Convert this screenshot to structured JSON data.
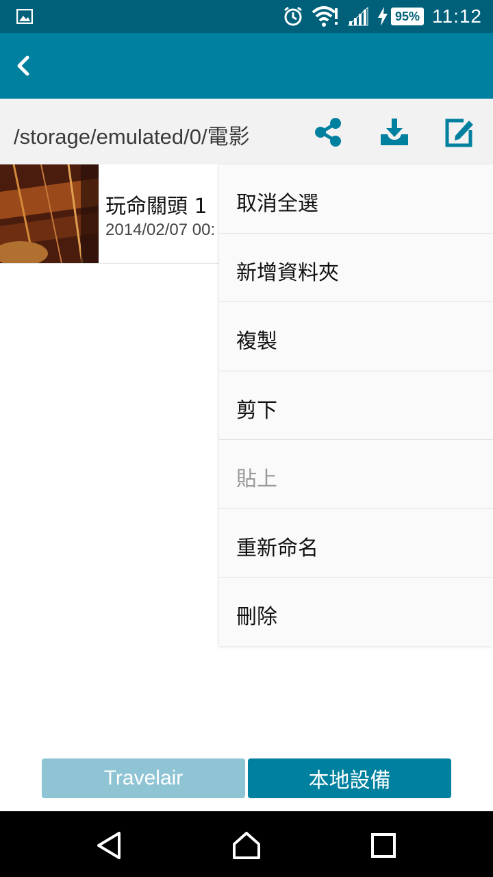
{
  "status_bar": {
    "battery": "95%",
    "time": "11:12",
    "icons": [
      "gallery-icon",
      "alarm-icon",
      "wifi-icon",
      "signal-icon",
      "charging-icon",
      "battery-icon"
    ]
  },
  "app_bar": {
    "back_icon": "chevron-left-icon"
  },
  "path_bar": {
    "path": "/storage/emulated/0/電影",
    "actions": [
      "share-icon",
      "download-icon",
      "edit-icon"
    ]
  },
  "files": [
    {
      "title": "玩命關頭 1",
      "date": "2014/02/07 00:"
    }
  ],
  "menu": {
    "items": [
      {
        "label": "取消全選",
        "enabled": true
      },
      {
        "label": "新增資料夾",
        "enabled": true
      },
      {
        "label": "複製",
        "enabled": true
      },
      {
        "label": "剪下",
        "enabled": true
      },
      {
        "label": "貼上",
        "enabled": false
      },
      {
        "label": "重新命名",
        "enabled": true
      },
      {
        "label": "刪除",
        "enabled": true
      }
    ]
  },
  "toggle": {
    "travelair": "Travelair",
    "local": "本地設備",
    "selected": "local"
  },
  "colors": {
    "status_bar": "#00607a",
    "app_bar": "#00809f",
    "toggle_selected": "#00809f",
    "toggle_unselected": "#8ec4d3"
  }
}
